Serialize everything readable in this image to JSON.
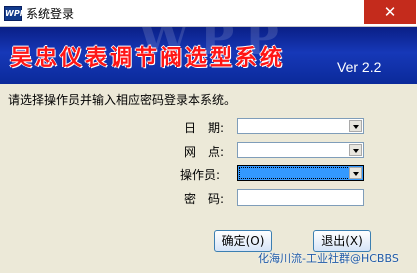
{
  "window": {
    "title": "系统登录",
    "icon_text": "WPP",
    "close_glyph": "✕"
  },
  "banner": {
    "watermark": "WPP",
    "title": "吴忠仪表调节阀选型系统",
    "version": "Ver 2.2"
  },
  "instruction": "请选择操作员并输入相应密码登录本系统。",
  "form": {
    "date_label": "日　期:",
    "date_value": "",
    "site_label": "网　点:",
    "site_value": "",
    "operator_label": "操作员:",
    "operator_value": "",
    "password_label": "密　码:",
    "password_value": ""
  },
  "buttons": {
    "ok": "确定(O)",
    "exit": "退出(X)"
  },
  "footer_watermark": "化海川流-工业社群@HCBBS",
  "colors": {
    "banner_bg": "#0b2a9a",
    "banner_title": "#ff1616",
    "selection": "#3399ff",
    "close_red": "#c42b1c"
  }
}
